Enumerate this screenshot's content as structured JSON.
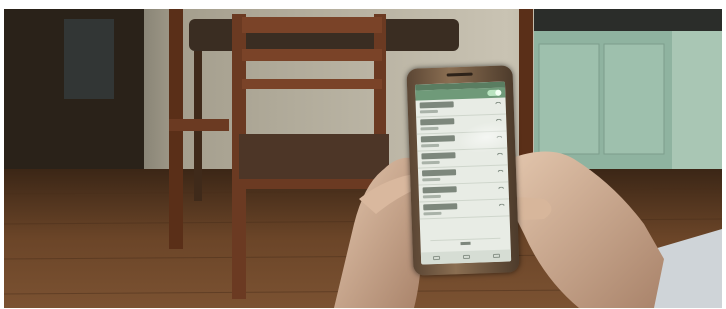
{
  "scene": {
    "description_free": true,
    "colors": {
      "floor": "#5a3a22",
      "wall": "#b9b3a3",
      "cabinet": "#8fb3a0",
      "chair": "#6b3a22",
      "skin": "#c6a48c",
      "phone_screen": "#e8ece5",
      "phone_accent": "#6f9a79"
    }
  },
  "phone": {
    "screen_type": "wifi-list",
    "wifi_networks": [
      {
        "icon": "wifi-signal-icon"
      },
      {
        "icon": "wifi-signal-icon"
      },
      {
        "icon": "wifi-signal-icon"
      },
      {
        "icon": "wifi-signal-icon"
      },
      {
        "icon": "wifi-signal-icon"
      },
      {
        "icon": "wifi-signal-icon"
      },
      {
        "icon": "wifi-signal-icon"
      }
    ],
    "nav_icons": [
      "back-icon",
      "home-icon",
      "recent-apps-icon"
    ]
  }
}
